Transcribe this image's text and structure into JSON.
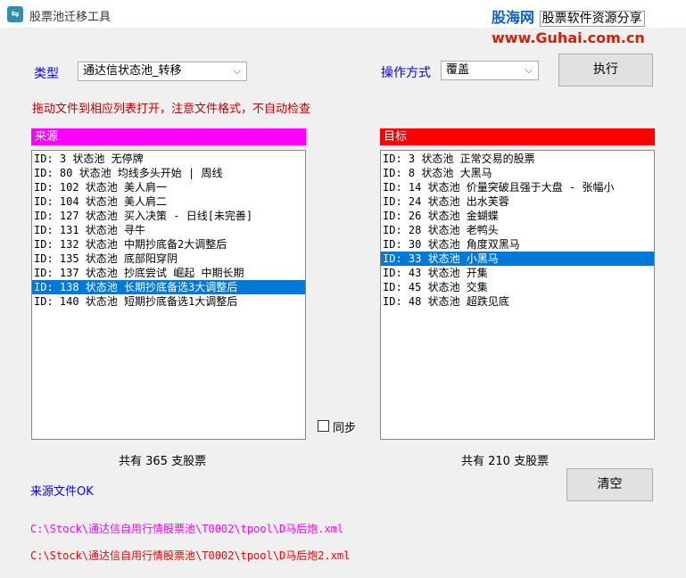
{
  "window": {
    "title": "股票池迁移工具",
    "icon": "app-icon"
  },
  "watermark": {
    "brand": "股海网",
    "slogan": "股票软件资源分享",
    "url": "www.Guhai.com.cn"
  },
  "type_label": "类型",
  "type_select": {
    "value": "通达信状态池_转移"
  },
  "op_label": "操作方式",
  "op_select": {
    "value": "覆盖"
  },
  "execute_button": "执行",
  "hint": "拖动文件到相应列表打开，注意文件格式，不自动检查",
  "source": {
    "header": "来源",
    "header_color": "#ff00ff",
    "items": [
      "ID: 3   状态池 无停牌",
      "ID: 80  状态池 均线多头开始 | 周线",
      "ID: 102 状态池 美人肩一",
      "ID: 104 状态池 美人肩二",
      "ID: 127 状态池 买入决策 - 日线[未完善]",
      "ID: 131 状态池 寻牛",
      "ID: 132 状态池 中期抄底备2大调整后",
      "ID: 135 状态池 底部阳穿阴",
      "ID: 137 状态池 抄底尝试 崛起 中期长期",
      "ID: 138 状态池 长期抄底备选3大调整后",
      "ID: 140 状态池 短期抄底备选1大调整后"
    ],
    "selected_index": 9,
    "count_text": "共有 365 支股票"
  },
  "target": {
    "header": "目标",
    "header_color": "#ff0000",
    "items": [
      "ID: 3   状态池 正常交易的股票",
      "ID: 8   状态池 大黑马",
      "ID: 14  状态池 价量突破且强于大盘 - 张幅小",
      "ID: 24  状态池 出水芙蓉",
      "ID: 26  状态池 金蝴蝶",
      "ID: 28  状态池 老鸭头",
      "ID: 30  状态池 角度双黑马",
      "ID: 33  状态池 小黑马",
      "ID: 43  状态池 开集",
      "ID: 45  状态池 交集",
      "ID: 48  状态池 超跌见底"
    ],
    "selected_index": 7,
    "count_text": "共有 210 支股票"
  },
  "sync_label": "同步",
  "status_text": "来源文件OK",
  "clear_button": "清空",
  "source_path": "C:\\Stock\\通达信自用行情股票池\\T0002\\tpool\\D马后炮.xml",
  "target_path": "C:\\Stock\\通达信自用行情股票池\\T0002\\tpool\\D马后炮2.xml",
  "colors": {
    "accent_blue": "#0000ff",
    "hint_red": "#c00000",
    "path_magenta": "#ff00ff",
    "path_red": "#ff0000",
    "selection": "#0078d7"
  }
}
